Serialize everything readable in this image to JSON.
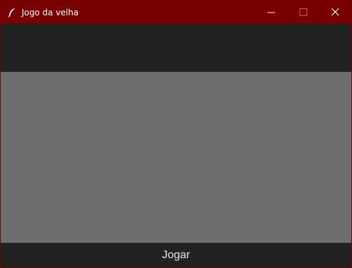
{
  "window": {
    "title": "Jogo da velha",
    "icon": "feather-icon",
    "controls": {
      "minimize_icon": "minimize-icon",
      "maximize_icon": "maximize-icon",
      "close_icon": "close-icon"
    }
  },
  "game": {
    "play_label": "Jogar"
  },
  "colors": {
    "titlebar": "#780000",
    "background": "#222222",
    "board": "#6e6e6e",
    "text": "#ffffff"
  }
}
